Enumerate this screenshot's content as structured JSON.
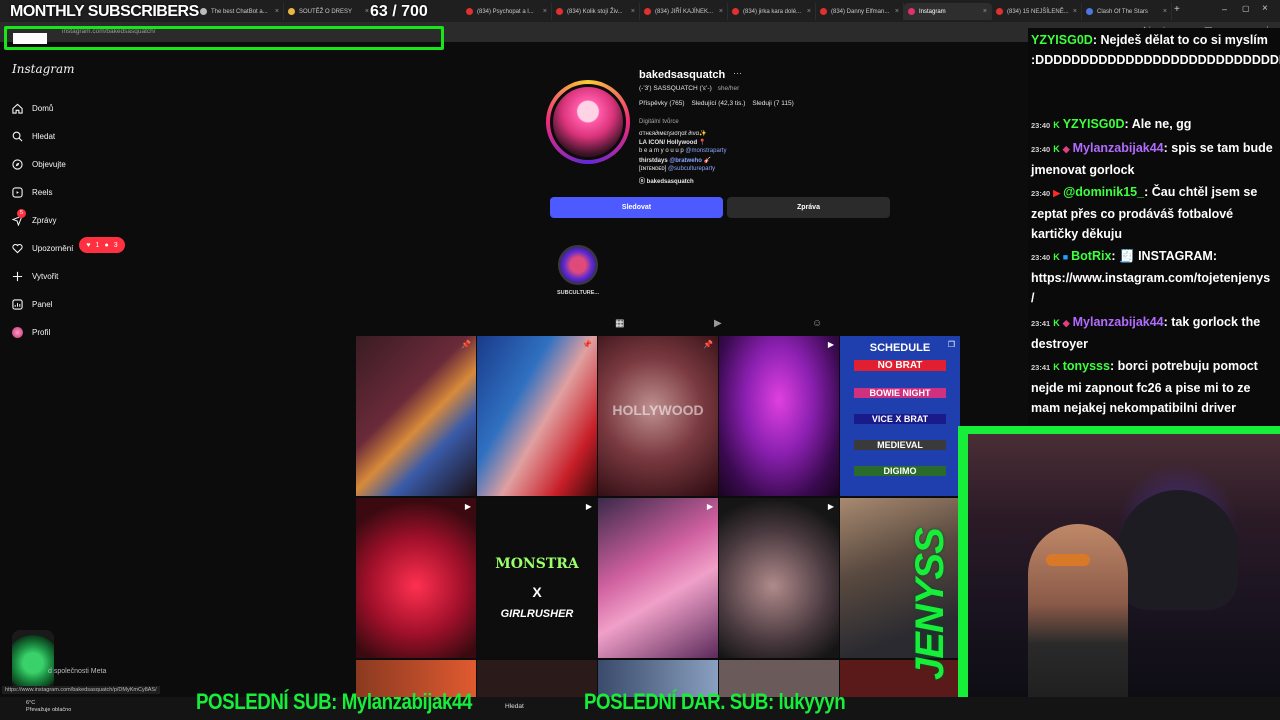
{
  "overlay": {
    "subs_title": "MONTHLY SUBSCRIBERS",
    "subs_count": "63 / 700",
    "last_sub": "POSLEDNÍ SUB: Mylanzabijak44",
    "last_dar": "POSLEDNÍ DAR. SUB: lukyyyn",
    "brand": "JENYSS",
    "accent": "#17ee3a"
  },
  "browser": {
    "tabs": [
      {
        "label": "The best ChatBot a..."
      },
      {
        "label": "SOUTĚŽ O DRESY"
      },
      {
        "label": "(834) Psychopat a l..."
      },
      {
        "label": "(834) Kolik stojí Živ..."
      },
      {
        "label": "(834) JIŘÍ KAJÍNEK..."
      },
      {
        "label": "(834) jirka kara dolé..."
      },
      {
        "label": "(834) Danny Elfman..."
      },
      {
        "label": "Instagram"
      },
      {
        "label": "(834) 15 NEJŠÍLENĚ..."
      },
      {
        "label": "Clash Of The Stars"
      }
    ],
    "url": "instagram.com/bakedsasquatch/",
    "status_url": "https://www.instagram.com/bakedsasquatch/p/DMyKmCy8AS/"
  },
  "sidebar": {
    "logo": "Instagram",
    "items": [
      {
        "label": "Domů",
        "icon": "home-icon"
      },
      {
        "label": "Hledat",
        "icon": "search-icon"
      },
      {
        "label": "Objevujte",
        "icon": "compass-icon"
      },
      {
        "label": "Reels",
        "icon": "reels-icon"
      },
      {
        "label": "Zprávy",
        "icon": "messages-icon"
      },
      {
        "label": "Upozornění",
        "icon": "heart-icon"
      },
      {
        "label": "Vytvořit",
        "icon": "plus-icon"
      },
      {
        "label": "Panel",
        "icon": "dashboard-icon"
      },
      {
        "label": "Profil",
        "icon": "avatar-icon"
      }
    ],
    "notif_badge": {
      "likes": "1",
      "follows": "3"
    },
    "messages_badge": "5"
  },
  "profile": {
    "username": "bakedsasquatch",
    "more": "···",
    "fullname": "(-'3') SASSQUATCH (ʻεʻ-)",
    "pronouns": "she/her",
    "stats": {
      "posts": "Příspěvky (765)",
      "followers": "Sledující (42,3 tis.)",
      "following": "Sleduji (7 115)"
    },
    "category": "Digitální tvůrce",
    "bio": [
      {
        "text": "σтнєя∂ιмєηѕισηαℓ ∂ινα✨",
        "link": ""
      },
      {
        "text": "LA ICON/ Hollywood 📍",
        "link": ""
      },
      {
        "text": "b e a m y o u u p ",
        "link": "@monstraparty"
      },
      {
        "text": "thirstdays ",
        "link": "@bratweho 🎸"
      },
      {
        "text": "[ɪɴᴛᴇɴᴅᴇᴅ] ",
        "link": "@subcultureparty"
      },
      {
        "text": "ⓞ bakedsasquatch",
        "link": ""
      }
    ],
    "follow_label": "Sledovat",
    "message_label": "Zpráva",
    "highlight_label": "SUBCULTURE..."
  },
  "grid": {
    "captions": {
      "c5_lines": [
        "SCHEDULE",
        "NO BRAT",
        "BOWIE NIGHT",
        "VICE X BRAT",
        "MEDIEVAL",
        "DIGIMO"
      ],
      "c7_top": "MONSTRA",
      "c7_mid": "X",
      "c7_bot": "GIRLRUSHER",
      "c3_text": "HOLLYWOOD"
    }
  },
  "chat": {
    "messages": [
      {
        "time": "",
        "user": "YZYISG0D",
        "user_class": "",
        "text": "Nejdeš dělat to co si myslím :DDDDDDDDDDDDDDDDDDDDDDDDDDDDDDDDD"
      },
      {
        "time": "23:40",
        "user": "YZYISG0D",
        "user_class": "",
        "text": "Ale ne, gg"
      },
      {
        "time": "23:40",
        "user": "Mylanzabijak44",
        "user_class": "purple",
        "text": "spis se tam bude jmenovat gorlock"
      },
      {
        "time": "23:40",
        "user": "@dominik15_",
        "user_class": "",
        "text": "Čau chtěl jsem se zeptat přes co prodáváš fotbalové kartičky děkuju"
      },
      {
        "time": "23:40",
        "user": "BotRix",
        "user_class": "",
        "text": "🧾 INSTAGRAM: https://www.instagram.com/tojetenjenys /"
      },
      {
        "time": "23:41",
        "user": "Mylanzabijak44",
        "user_class": "purple",
        "text": "tak gorlock the destroyer"
      },
      {
        "time": "23:41",
        "user": "tonysss",
        "user_class": "",
        "text": "borci potrebuju pomoct nejde mi zapnout fc26 a pise mi to ze mam nejakej nekompatibilni driver"
      }
    ]
  },
  "footer": {
    "meta": "d společnosti Meta",
    "weather_temp": "6°C",
    "weather_desc": "Převažuje oblačno",
    "search": "Hledat"
  }
}
